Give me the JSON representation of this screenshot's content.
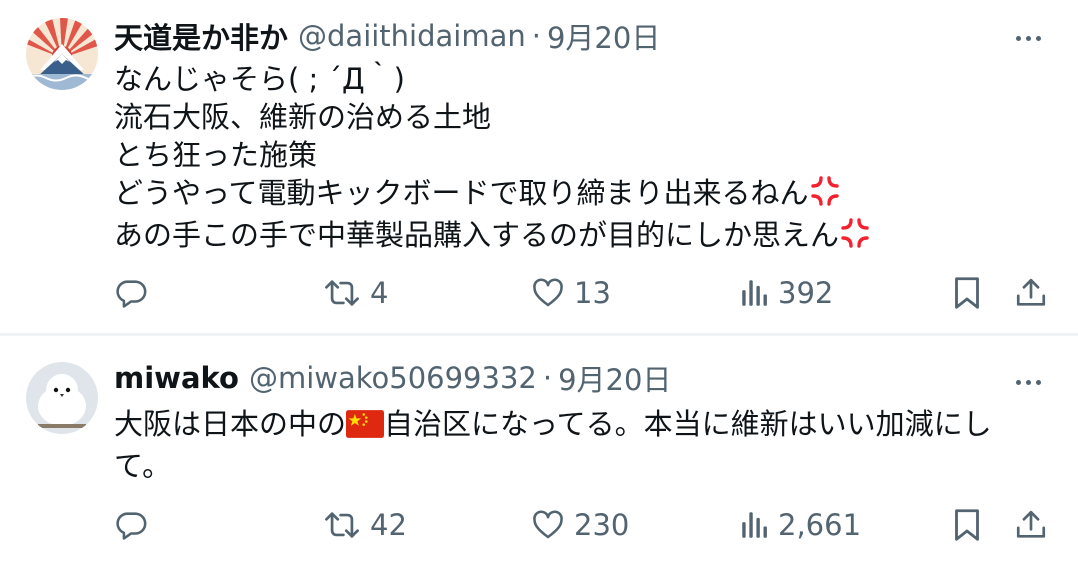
{
  "tweets": [
    {
      "display_name": "天道是か非か",
      "handle": "@daiithidaiman",
      "separator": "·",
      "date": "9月20日",
      "lines": [
        "なんじゃそら( ; ´Д｀)",
        "流石大阪、維新の治める土地",
        "とち狂った施策",
        "どうやって電動キックボードで取り締まり出来るねん",
        "あの手この手で中華製品購入するのが目的にしか思えん"
      ],
      "inline_emoji": [
        "anger-symbol",
        "anger-symbol"
      ],
      "stats": {
        "replies": "",
        "retweets": "4",
        "likes": "13",
        "views": "392"
      }
    },
    {
      "display_name": "miwako",
      "handle": "@miwako50699332",
      "separator": "·",
      "date": "9月20日",
      "text_before_flag": "大阪は日本の中の",
      "inline_emoji": [
        "china-flag"
      ],
      "text_after_flag": "自治区になってる。本当に維新はいい加減にして。",
      "stats": {
        "replies": "",
        "retweets": "42",
        "likes": "230",
        "views": "2,661"
      }
    }
  ],
  "icons": {
    "more": "more-dots-icon",
    "reply": "reply-icon",
    "retweet": "retweet-icon",
    "like": "heart-icon",
    "views": "views-chart-icon",
    "bookmark": "bookmark-icon",
    "share": "share-icon"
  },
  "colors": {
    "text": "#0f1419",
    "muted": "#536471",
    "divider": "#eff3f4",
    "anger": "#f4212e",
    "flag_red": "#de2910",
    "flag_star": "#ffde00"
  }
}
